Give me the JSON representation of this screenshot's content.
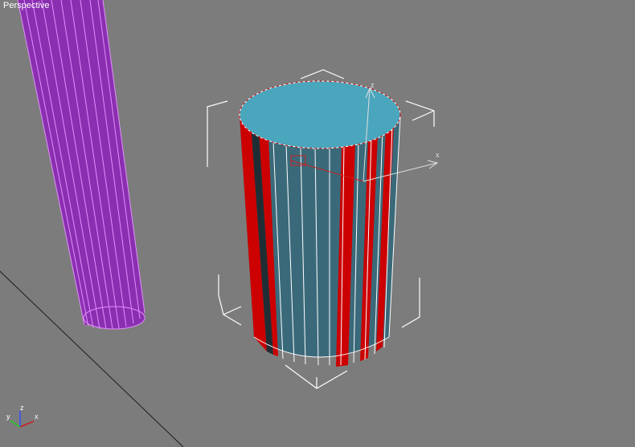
{
  "viewport": {
    "label": "Perspective",
    "background_color": "#7c7c7c"
  },
  "objects": {
    "selected_cylinder": {
      "cap_color": "#4aa6bd",
      "body_color": "#3a6a7a",
      "stripe_color": "#cc0000",
      "edge_color": "#ffffff"
    },
    "purple_cylinder": {
      "fill_color": "#8a2fb0",
      "edge_color": "#e38cff"
    }
  },
  "gizmo": {
    "z_label": "z",
    "x_label": "x"
  },
  "axis_tripod": {
    "x_label": "x",
    "y_label": "y",
    "z_label": "z",
    "x_color": "#cc2020",
    "y_color": "#20cc20",
    "z_color": "#3050ff"
  }
}
